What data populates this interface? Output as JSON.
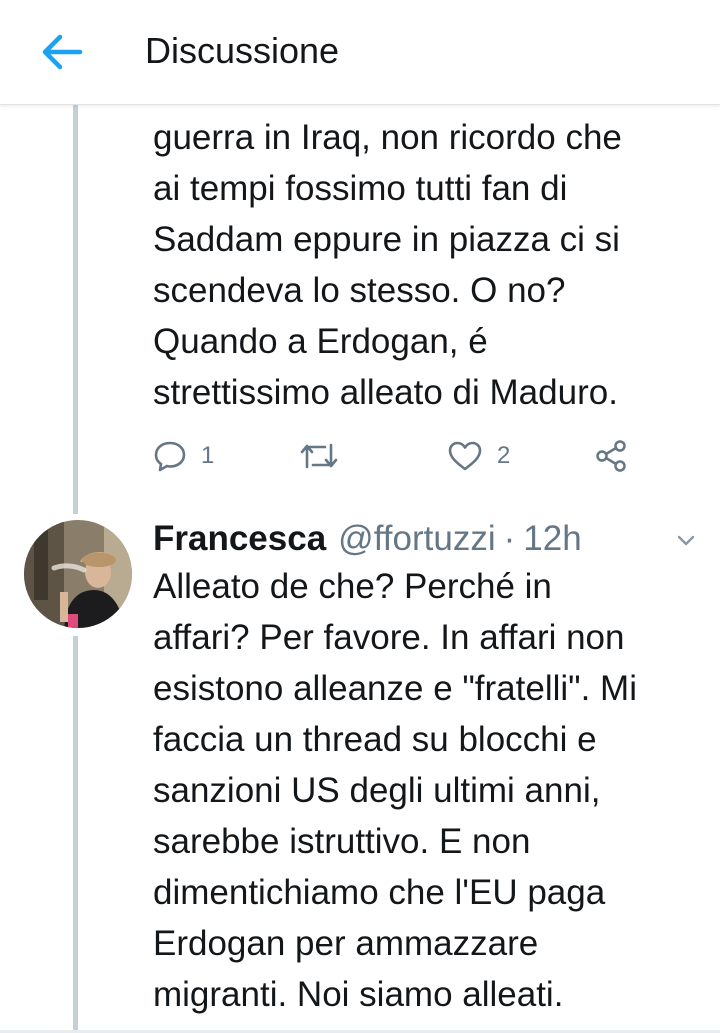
{
  "header": {
    "title": "Discussione",
    "back_icon": "arrow-left-icon",
    "accent_color": "#1da1f2"
  },
  "tweet_1": {
    "text": "guerra in Iraq, non ricordo che\nai tempi fossimo tutti fan di\nSaddam eppure in piazza ci si\nscendeva lo stesso. O no?\nQuando a Erdogan, é\nstrettissimo alleato di Maduro.",
    "actions": {
      "reply_count": "1",
      "retweet_count": "",
      "like_count": "2"
    }
  },
  "tweet_2": {
    "display_name": "Francesca",
    "handle": "@ffortuzzi",
    "separator": "·",
    "timestamp": "12h",
    "text": "Alleato de che? Perché in\naffari? Per favore. In affari non\nesistono alleanze e \"fratelli\". Mi\nfaccia un thread su blocchi e\nsanzioni US degli ultimi anni,\nsarebbe istruttivo. E non\ndimentichiamo che l'EU paga\nErdogan per ammazzare\nmigranti. Noi siamo alleati."
  },
  "icons": [
    "arrow-left-icon",
    "reply-icon",
    "retweet-icon",
    "heart-icon",
    "share-icon",
    "chevron-down-icon"
  ]
}
